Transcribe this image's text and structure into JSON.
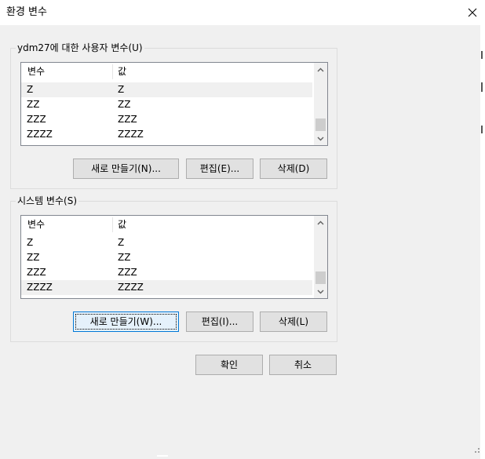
{
  "window": {
    "title": "환경 변수",
    "close_glyph": "close-icon"
  },
  "user_vars": {
    "group_label": "ydm27에 대한 사용자 변수(U)",
    "columns": [
      "변수",
      "값"
    ],
    "rows": [
      {
        "name": "Z",
        "value": "Z"
      },
      {
        "name": "ZZ",
        "value": "ZZ"
      },
      {
        "name": "ZZZ",
        "value": "ZZZ"
      },
      {
        "name": "ZZZZ",
        "value": "ZZZZ"
      }
    ],
    "selected_row": 0,
    "buttons": {
      "new": "새로 만들기(N)...",
      "edit": "편집(E)...",
      "delete": "삭제(D)"
    }
  },
  "system_vars": {
    "group_label": "시스템 변수(S)",
    "columns": [
      "변수",
      "값"
    ],
    "rows": [
      {
        "name": "Z",
        "value": "Z"
      },
      {
        "name": "ZZ",
        "value": "ZZ"
      },
      {
        "name": "ZZZ",
        "value": "ZZZ"
      },
      {
        "name": "ZZZZ",
        "value": "ZZZZ"
      }
    ],
    "selected_row": 3,
    "buttons": {
      "new": "새로 만들기(W)...",
      "edit": "편집(I)...",
      "delete": "삭제(L)"
    }
  },
  "footer": {
    "ok": "확인",
    "cancel": "취소"
  },
  "colors": {
    "focus_border": "#0078d7",
    "selection": "#f0f0f0",
    "dialog_bg": "#f0f0f0"
  }
}
